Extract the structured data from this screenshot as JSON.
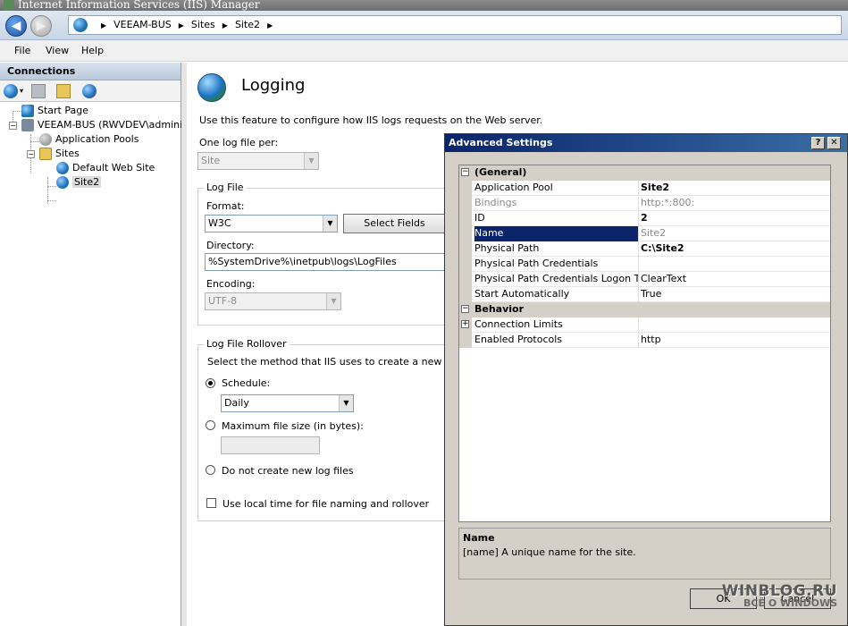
{
  "window": {
    "title": "Internet Information Services (IIS) Manager"
  },
  "address": {
    "crumbs": [
      "VEEAM-BUS",
      "Sites",
      "Site2"
    ]
  },
  "menu": {
    "items": [
      "File",
      "View",
      "Help"
    ]
  },
  "connections": {
    "header": "Connections",
    "tree": {
      "start_page": "Start Page",
      "server": "VEEAM-BUS (RWVDEV\\administra",
      "app_pools": "Application Pools",
      "sites": "Sites",
      "default_site": "Default Web Site",
      "site2": "Site2"
    }
  },
  "logging": {
    "title": "Logging",
    "description": "Use this feature to configure how IIS logs requests on the Web server.",
    "one_log_file_per_label": "One log file per:",
    "one_log_file_per_value": "Site",
    "log_file_group": "Log File",
    "format_label": "Format:",
    "format_value": "W3C",
    "select_fields_button": "Select Fields",
    "directory_label": "Directory:",
    "directory_value": "%SystemDrive%\\inetpub\\logs\\LogFiles",
    "encoding_label": "Encoding:",
    "encoding_value": "UTF-8",
    "rollover_group": "Log File Rollover",
    "rollover_desc": "Select the method that IIS uses to create a new log file",
    "schedule_label": "Schedule:",
    "schedule_value": "Daily",
    "max_size_label": "Maximum file size (in bytes):",
    "no_new_label": "Do not create new log files",
    "local_time_label": "Use local time for file naming and rollover"
  },
  "dialog": {
    "title": "Advanced Settings",
    "help_glyph": "?",
    "close_glyph": "✕",
    "categories": {
      "general": "(General)",
      "behavior": "Behavior"
    },
    "general_rows": [
      {
        "name": "Application Pool",
        "value": "Site2"
      },
      {
        "name": "Bindings",
        "value": "http:*:800:"
      },
      {
        "name": "ID",
        "value": "2"
      },
      {
        "name": "Name",
        "value": "Site2"
      },
      {
        "name": "Physical Path",
        "value": "C:\\Site2"
      },
      {
        "name": "Physical Path Credentials",
        "value": ""
      },
      {
        "name": "Physical Path Credentials Logon Type",
        "value": "ClearText"
      },
      {
        "name": "Start Automatically",
        "value": "True"
      }
    ],
    "behavior_rows": [
      {
        "name": "Connection Limits",
        "value": ""
      },
      {
        "name": "Enabled Protocols",
        "value": "http"
      }
    ],
    "description_title": "Name",
    "description_text": "[name] A unique name for the site.",
    "ok_button": "OK",
    "cancel_button": "Cancel"
  },
  "watermark": {
    "main": "WINBLOG.RU",
    "sub": "ВСЁ О WINDOWS"
  },
  "colors": {
    "dialog_title": "#0a246a",
    "selection": "#0a246a",
    "dialog_face": "#d4d0c8"
  }
}
